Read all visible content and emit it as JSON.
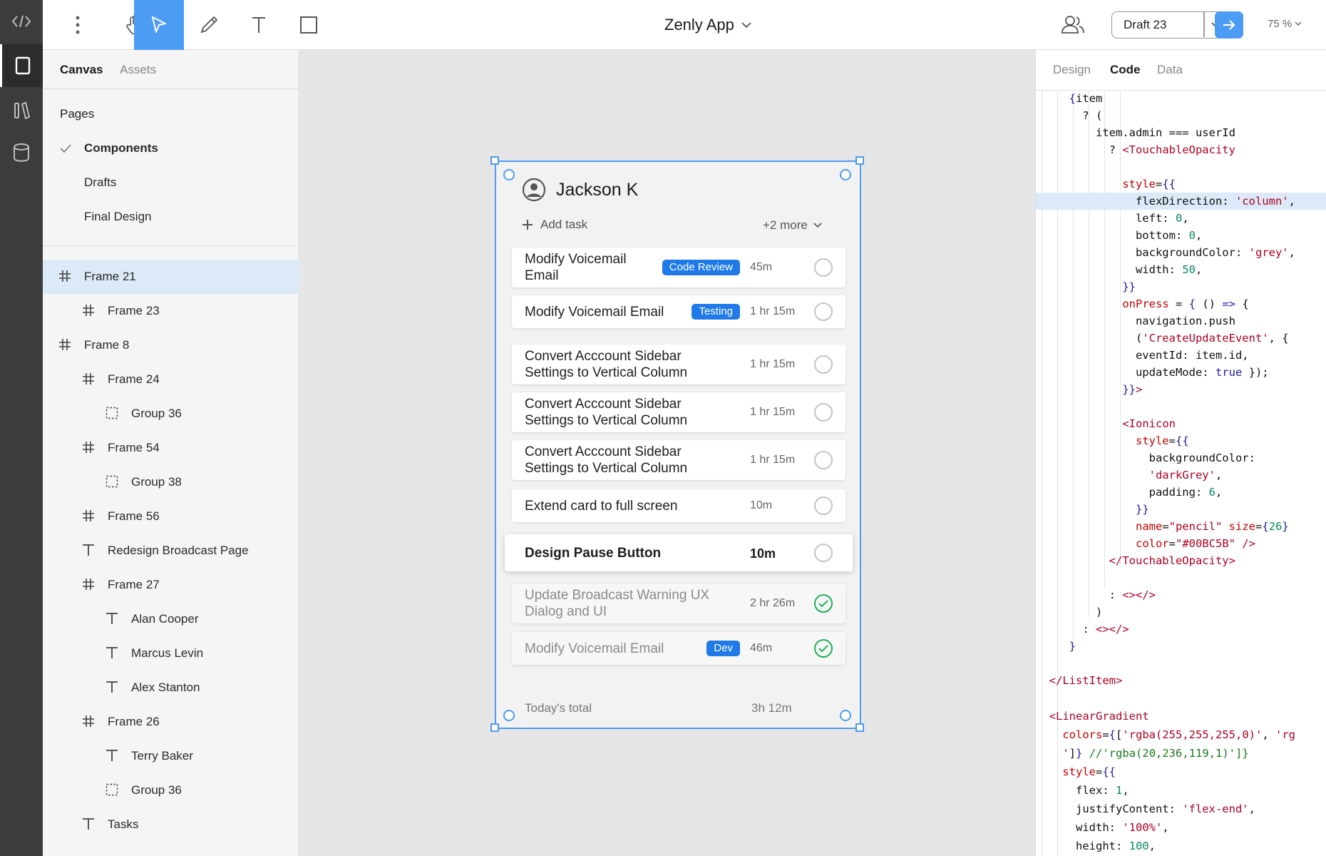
{
  "rail": {
    "items": [
      "code-icon",
      "frame-icon",
      "library-icon",
      "database-icon"
    ]
  },
  "toolbar": {
    "title": "Zenly App",
    "draft": "Draft 23",
    "zoom": "75 %",
    "accent": "#4d9cf3"
  },
  "left_panel": {
    "tabs": [
      "Canvas",
      "Assets"
    ],
    "pages_label": "Pages",
    "pages": [
      "Components",
      "Drafts",
      "Final Design"
    ],
    "layers": [
      {
        "type": "frame",
        "label": "Frame 21"
      },
      {
        "type": "frame",
        "label": "Frame 23"
      },
      {
        "type": "frame",
        "label": "Frame 8"
      },
      {
        "type": "frame",
        "label": "Frame 24"
      },
      {
        "type": "group",
        "label": "Group 36"
      },
      {
        "type": "frame",
        "label": "Frame 54"
      },
      {
        "type": "group",
        "label": "Group 38"
      },
      {
        "type": "frame",
        "label": "Frame 56"
      },
      {
        "type": "text",
        "label": "Redesign Broadcast Page"
      },
      {
        "type": "frame",
        "label": "Frame 27"
      },
      {
        "type": "text",
        "label": "Alan Cooper"
      },
      {
        "type": "text",
        "label": "Marcus Levin"
      },
      {
        "type": "text",
        "label": "Alex Stanton"
      },
      {
        "type": "frame",
        "label": "Frame 26"
      },
      {
        "type": "text",
        "label": "Terry Baker"
      },
      {
        "type": "group",
        "label": "Group 36"
      },
      {
        "type": "text",
        "label": "Tasks"
      }
    ]
  },
  "canvas": {
    "user": "Jackson K",
    "add_task": "Add task",
    "more": "+2 more",
    "tasks": [
      {
        "title": "Modify Voicemail\nEmail",
        "badge": "Code Review",
        "time": "45m",
        "done": false
      },
      {
        "title": "Modify Voicemail Email",
        "badge": "Testing",
        "time": "1 hr 15m",
        "done": false
      },
      {
        "title": "Convert Acccount Sidebar\nSettings to Vertical Column",
        "badge": "",
        "time": "1 hr 15m",
        "done": false
      },
      {
        "title": "Convert Acccount Sidebar\nSettings to Vertical Column",
        "badge": "",
        "time": "1 hr 15m",
        "done": false
      },
      {
        "title": "Convert Acccount Sidebar\nSettings to Vertical Column",
        "badge": "",
        "time": "1 hr 15m",
        "done": false
      },
      {
        "title": "Extend card to full screen",
        "badge": "",
        "time": "10m",
        "done": false
      },
      {
        "title": "Design Pause Button",
        "badge": "",
        "time": "10m",
        "done": false
      },
      {
        "title": "Update Broadcast Warning UX\nDialog and UI",
        "badge": "",
        "time": "2 hr 26m",
        "done": true
      },
      {
        "title": "Modify Voicemail Email",
        "badge": "Dev",
        "time": "46m",
        "done": true
      }
    ],
    "total_label": "Today's total",
    "total_value": "3h 12m"
  },
  "right_panel": {
    "tabs": [
      "Design",
      "Code",
      "Data"
    ],
    "active_tab": "Code"
  }
}
